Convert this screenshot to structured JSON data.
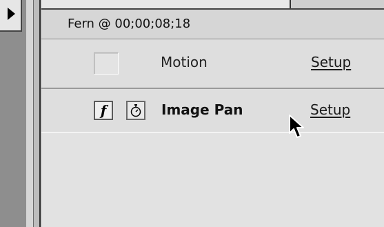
{
  "panel": {
    "header_title": "Fern @ 00;00;08;18"
  },
  "effects": [
    {
      "name": "Motion",
      "setup_label": "Setup",
      "enabled": false
    },
    {
      "name": "Image Pan",
      "setup_label": "Setup",
      "enabled": true,
      "has_fx_toggle": true,
      "has_keyframe_toggle": true
    }
  ],
  "icons": {
    "expand": "triangle-right-icon",
    "fx": "function-f-icon",
    "keyframe": "stopwatch-icon",
    "cursor": "arrow-cursor-icon"
  },
  "fx_glyph": "f"
}
